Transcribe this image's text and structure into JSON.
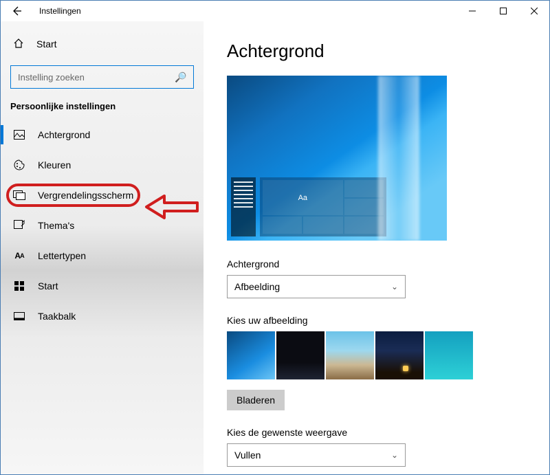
{
  "window": {
    "title": "Instellingen"
  },
  "sidebar": {
    "home_label": "Start",
    "search_placeholder": "Instelling zoeken",
    "section_title": "Persoonlijke instellingen",
    "items": [
      {
        "label": "Achtergrond"
      },
      {
        "label": "Kleuren"
      },
      {
        "label": "Vergrendelingsscherm"
      },
      {
        "label": "Thema's"
      },
      {
        "label": "Lettertypen"
      },
      {
        "label": "Start"
      },
      {
        "label": "Taakbalk"
      }
    ]
  },
  "main": {
    "page_title": "Achtergrond",
    "preview_sample_text": "Aa",
    "bg_label": "Achtergrond",
    "bg_dropdown_value": "Afbeelding",
    "choose_label": "Kies uw afbeelding",
    "browse_label": "Bladeren",
    "fit_label": "Kies de gewenste weergave",
    "fit_dropdown_value": "Vullen"
  }
}
